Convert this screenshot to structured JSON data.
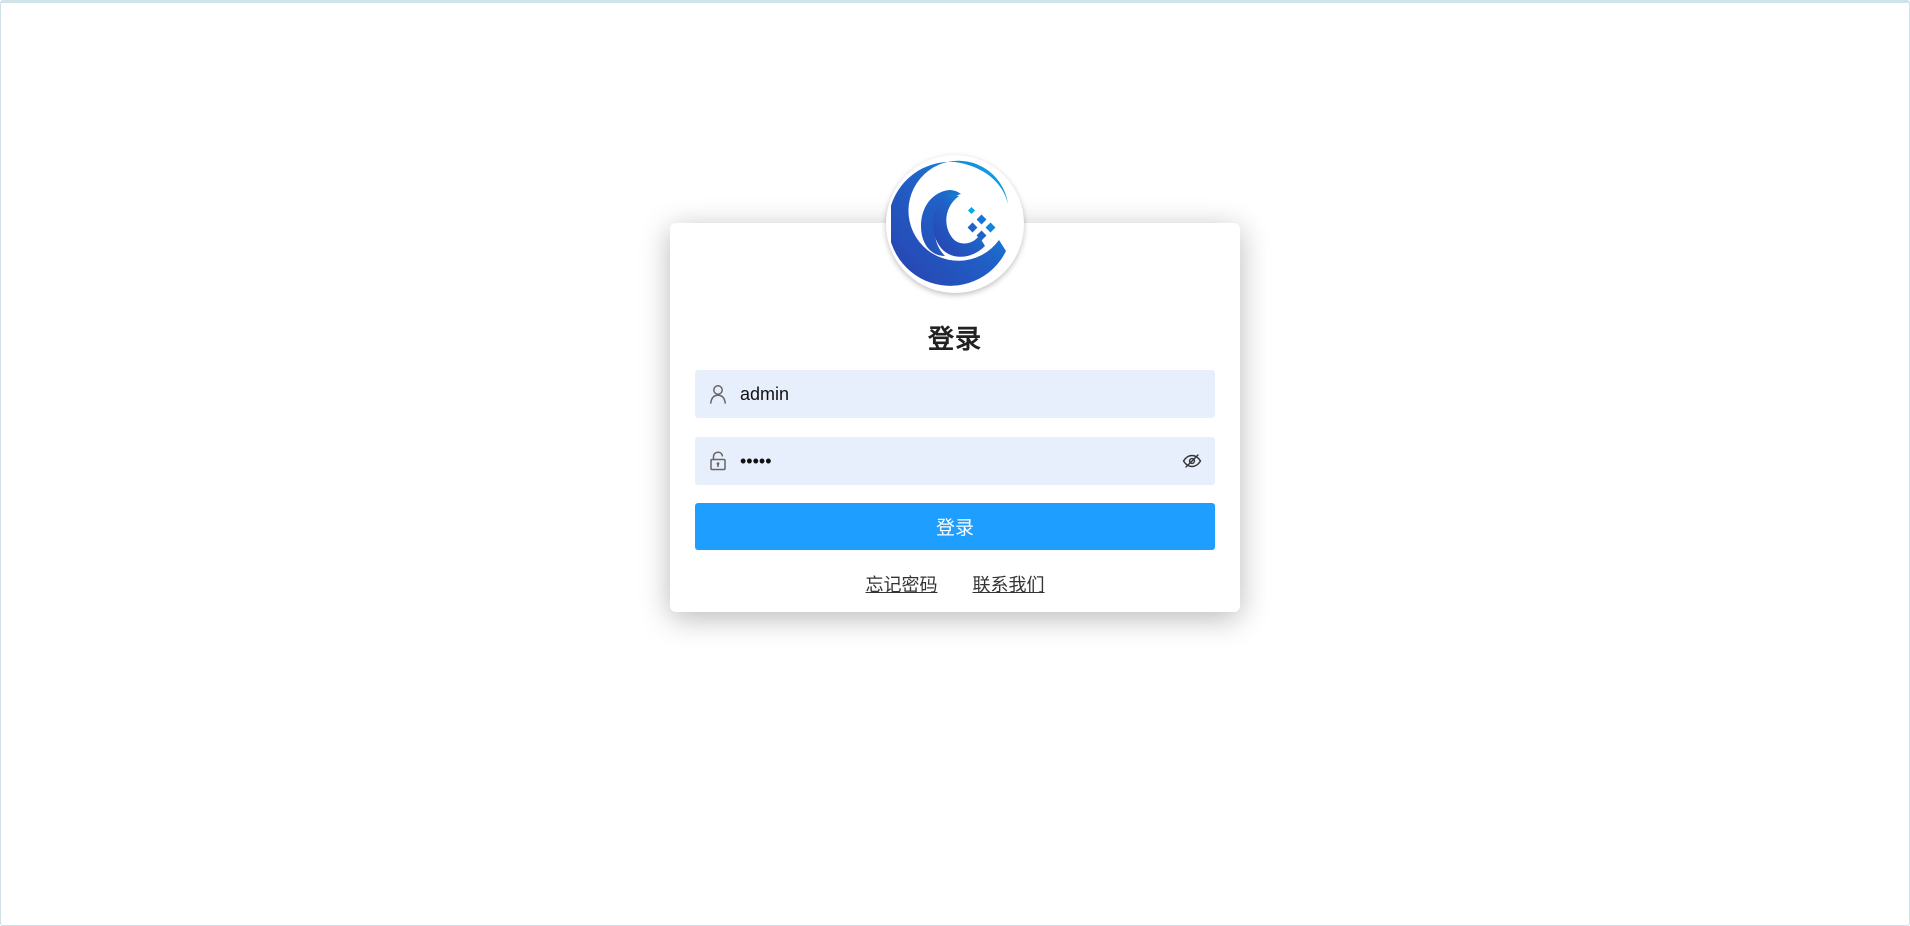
{
  "login": {
    "title": "登录",
    "username": {
      "value": "admin",
      "icon": "user-icon"
    },
    "password": {
      "value": "•••••",
      "icon": "unlock-icon",
      "toggle_icon": "eye-off-icon"
    },
    "submit_label": "登录",
    "links": {
      "forgot_password": "忘记密码",
      "contact_us": "联系我们"
    }
  },
  "colors": {
    "accent": "#1e9eff",
    "input_background": "#e8effc",
    "logo_blue": "#2a3fae",
    "logo_cyan": "#0aa8e6"
  }
}
